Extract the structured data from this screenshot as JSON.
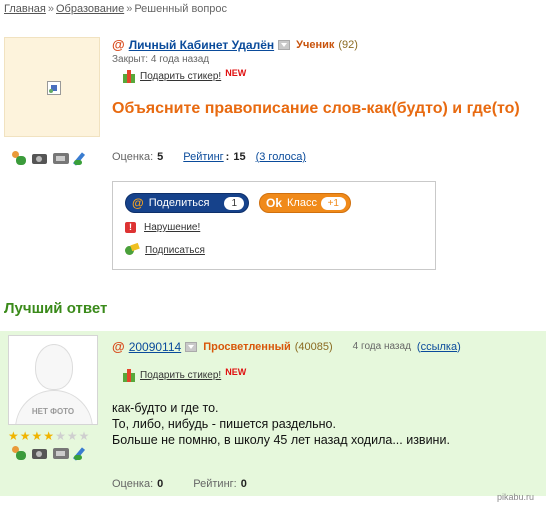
{
  "breadcrumb": {
    "items": [
      "Главная",
      "Образование",
      "Решенный вопрос"
    ],
    "separator": "»"
  },
  "question": {
    "author": "Личный Кабинет Удалён",
    "author_rank": "Ученик",
    "author_score": "(92)",
    "closed_text": "Закрыт: 4 года назад",
    "gift_label": "Подарить стикер!",
    "gift_new": "NEW",
    "title": "Объясните правописание слов-как(будто) и где(то)",
    "score_label": "Оценка:",
    "score_value": "5",
    "rating_label": "Рейтинг",
    "rating_value": "15",
    "votes_label": "(3 голоса)"
  },
  "share": {
    "mailru_label": "Поделиться",
    "mailru_icon": "@",
    "mailru_count": "1",
    "ok_label": "Класс",
    "ok_icon": "Ok",
    "ok_count": "+1",
    "violation_label": "Нарушение!",
    "subscribe_label": "Подписаться"
  },
  "best_answer": {
    "heading": "Лучший ответ",
    "author": "20090114",
    "author_rank": "Просветленный",
    "author_score": "(40085)",
    "time": "4 года назад",
    "link_open": "(",
    "link_label": "ссылка",
    "link_close": ")",
    "no_photo": "НЕТ ФОТО",
    "stars_filled": 4,
    "stars_total": 7,
    "gift_label": "Подарить стикер!",
    "gift_new": "NEW",
    "text_lines": [
      "как-будто и где то.",
      "То, либо, нибудь - пишется раздельно.",
      "Больше не помню, в школу 45 лет назад ходила... извини."
    ],
    "score_label": "Оценка:",
    "score_value": "0",
    "rating_label": "Рейтинг:",
    "rating_value": "0"
  },
  "watermark": "pikabu.ru",
  "icons": {
    "author_prefix": "@",
    "profile_icons": [
      "people-icon",
      "camera-icon",
      "video-icon",
      "pencil-icon"
    ]
  },
  "colors": {
    "link": "#0a4b9b",
    "title_orange": "#e86a10",
    "best_answer_green": "#3a8a1a",
    "answer_bg": "#e6f8dc"
  }
}
